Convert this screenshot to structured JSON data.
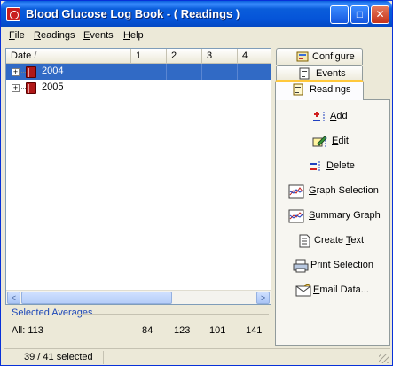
{
  "window": {
    "title": "Blood Glucose Log Book - ( Readings )",
    "minimize": "_",
    "maximize": "□",
    "close": "✕"
  },
  "menu": [
    {
      "underline": "F",
      "rest": "ile"
    },
    {
      "underline": "R",
      "rest": "eadings"
    },
    {
      "underline": "E",
      "rest": "vents"
    },
    {
      "underline": "H",
      "rest": "elp"
    }
  ],
  "list": {
    "columns": [
      "Date",
      "1",
      "2",
      "3",
      "4"
    ],
    "sort_indicator": "/",
    "rows": [
      {
        "label": "2004",
        "selected": true,
        "expander": "+"
      },
      {
        "label": "2005",
        "selected": false,
        "expander": "+"
      }
    ],
    "scroll_left": "<",
    "scroll_right": ">"
  },
  "averages": {
    "label": "Selected Averages",
    "all": "All: 113",
    "values": [
      "84",
      "123",
      "101",
      "141"
    ]
  },
  "status": {
    "text": "39 / 41 selected"
  },
  "tabs": [
    {
      "label": "Configure",
      "icon": "configure-icon"
    },
    {
      "label": "Events",
      "icon": "events-icon"
    },
    {
      "label": "Readings",
      "icon": "readings-icon",
      "active": true
    }
  ],
  "commands": [
    {
      "pre": "",
      "u": "A",
      "post": "dd",
      "icon": "add-icon"
    },
    {
      "pre": "",
      "u": "E",
      "post": "dit",
      "icon": "edit-icon"
    },
    {
      "pre": "",
      "u": "D",
      "post": "elete",
      "icon": "delete-icon"
    },
    {
      "pre": "",
      "u": "G",
      "post": "raph Selection",
      "icon": "graph-icon"
    },
    {
      "pre": "",
      "u": "S",
      "post": "ummary Graph",
      "icon": "summary-graph-icon"
    },
    {
      "pre": "Create ",
      "u": "T",
      "post": "ext",
      "icon": "text-document-icon"
    },
    {
      "pre": "",
      "u": "P",
      "post": "rint Selection",
      "icon": "printer-icon"
    },
    {
      "pre": "",
      "u": "E",
      "post": "mail Data...",
      "icon": "email-icon"
    }
  ],
  "colors": {
    "selection": "#316ac5",
    "titlebar": "#0554d8",
    "averages_label": "#1c47b8"
  }
}
